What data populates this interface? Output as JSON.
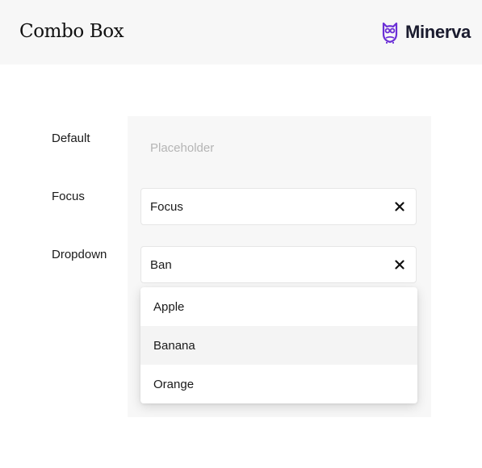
{
  "header": {
    "title": "Combo Box",
    "brand": {
      "name": "Minerva",
      "icon": "owl-logo-icon",
      "color": "#6b2fd6"
    }
  },
  "rows": [
    {
      "label": "Default",
      "placeholder": "Placeholder"
    },
    {
      "label": "Focus",
      "value": "Focus",
      "clear_icon": "close-icon"
    },
    {
      "label": "Dropdown",
      "value": "Ban",
      "clear_icon": "close-icon"
    }
  ],
  "dropdown": {
    "options": [
      {
        "label": "Apple"
      },
      {
        "label": "Banana",
        "highlighted": true
      },
      {
        "label": "Orange"
      }
    ]
  },
  "colors": {
    "panel_background": "#f7f7f7",
    "placeholder_text": "#b5b5b5",
    "highlight_background": "#f4f4f4"
  }
}
